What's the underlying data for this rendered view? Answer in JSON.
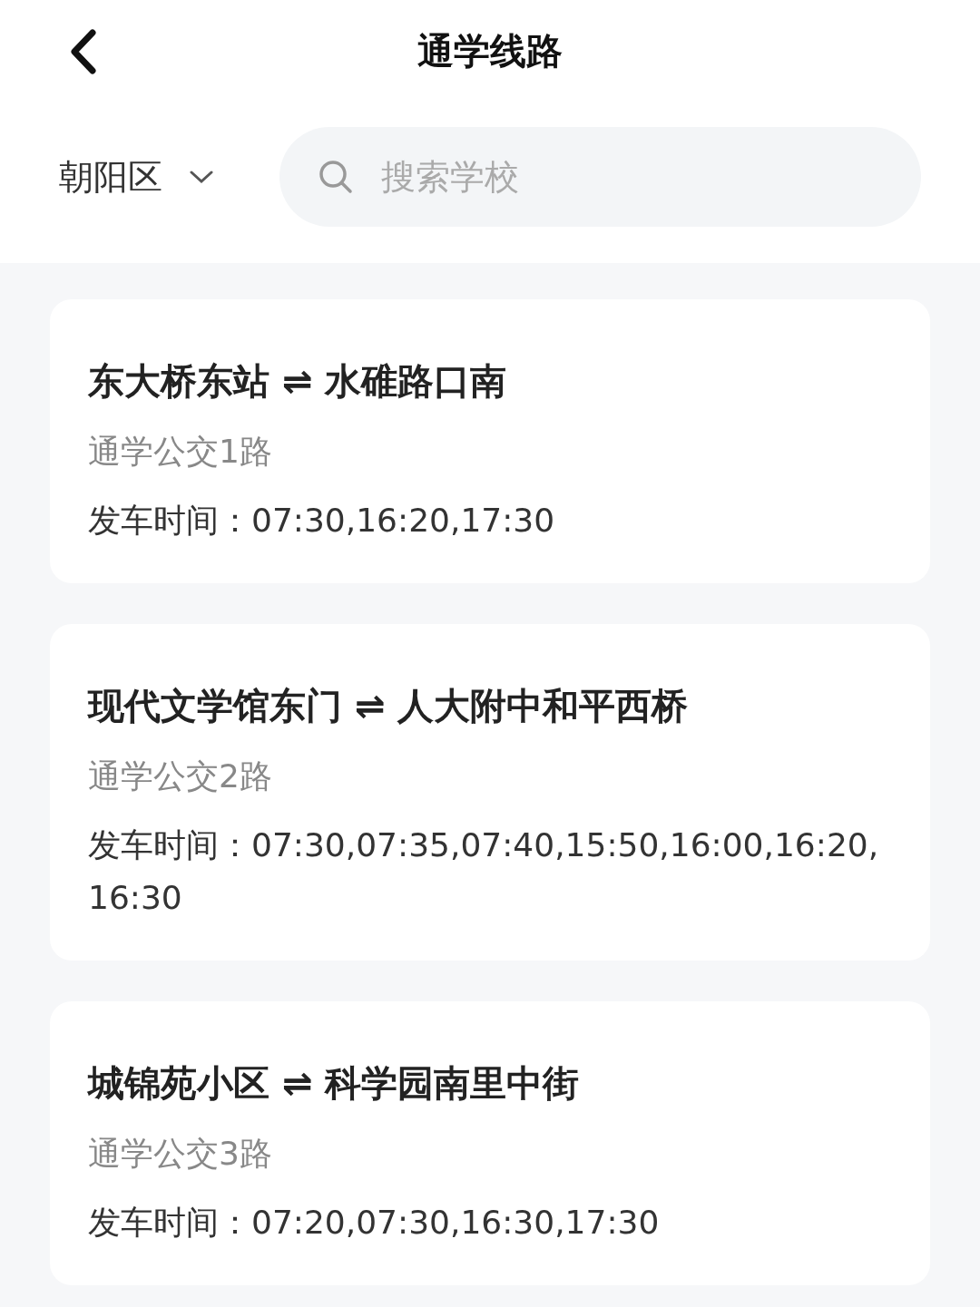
{
  "header": {
    "title": "通学线路"
  },
  "filter": {
    "district": "朝阳区"
  },
  "search": {
    "placeholder": "搜索学校"
  },
  "routes": [
    {
      "title": "东大桥东站 ⇌ 水碓路口南",
      "line": "通学公交1路",
      "times": "发车时间：07:30,16:20,17:30"
    },
    {
      "title": "现代文学馆东门 ⇌ 人大附中和平西桥",
      "line": "通学公交2路",
      "times": "发车时间：07:30,07:35,07:40,15:50,16:00,16:20,16:30"
    },
    {
      "title": "城锦苑小区 ⇌ 科学园南里中街",
      "line": "通学公交3路",
      "times": "发车时间：07:20,07:30,16:30,17:30"
    }
  ]
}
